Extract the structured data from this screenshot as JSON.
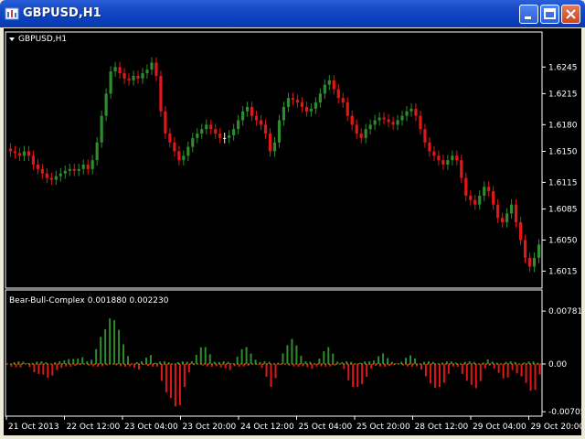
{
  "window": {
    "title": "GBPUSD,H1"
  },
  "colors": {
    "bull": "#2e8b2e",
    "bear": "#e01818",
    "doji": "#ffffff",
    "bg": "#000000",
    "grid": "#ffffff",
    "zero": "#a0a000"
  },
  "main_chart": {
    "label": "GBPUSD,H1",
    "y_labels": [
      "1.6245",
      "1.6215",
      "1.6180",
      "1.6150",
      "1.6115",
      "1.6085",
      "1.6050",
      "1.6015"
    ],
    "y_range": [
      1.6,
      1.627
    ]
  },
  "indicator": {
    "label": "Bear-Bull-Complex 0.001880 0.002230",
    "y_labels": [
      "0.00781",
      "0.00",
      "-0.00705"
    ],
    "y_range": [
      -0.0077,
      0.0085
    ]
  },
  "x_labels": [
    "21 Oct 2013",
    "22 Oct 12:00",
    "23 Oct 04:00",
    "23 Oct 20:00",
    "24 Oct 12:00",
    "25 Oct 04:00",
    "25 Oct 20:00",
    "28 Oct 12:00",
    "29 Oct 04:00",
    "29 Oct 20:00"
  ],
  "chart_data": {
    "type": "candlestick",
    "title": "GBPUSD,H1",
    "y_range": [
      1.6,
      1.627
    ],
    "closes": [
      1.615,
      1.6148,
      1.6145,
      1.615,
      1.6145,
      1.6135,
      1.613,
      1.6125,
      1.612,
      1.6118,
      1.6122,
      1.6125,
      1.6128,
      1.613,
      1.6128,
      1.613,
      1.6135,
      1.613,
      1.614,
      1.616,
      1.619,
      1.6215,
      1.624,
      1.6245,
      1.6238,
      1.6232,
      1.623,
      1.6235,
      1.6232,
      1.6238,
      1.6242,
      1.625,
      1.6235,
      1.6195,
      1.617,
      1.616,
      1.615,
      1.614,
      1.6145,
      1.6155,
      1.6165,
      1.617,
      1.6175,
      1.618,
      1.6175,
      1.617,
      1.6165,
      1.6165,
      1.6168,
      1.6175,
      1.6185,
      1.6195,
      1.62,
      1.619,
      1.6185,
      1.618,
      1.617,
      1.615,
      1.616,
      1.6185,
      1.62,
      1.621,
      1.6208,
      1.6205,
      1.62,
      1.6195,
      1.6198,
      1.6205,
      1.6215,
      1.6225,
      1.623,
      1.622,
      1.621,
      1.6205,
      1.619,
      1.618,
      1.617,
      1.6165,
      1.6175,
      1.618,
      1.6185,
      1.6188,
      1.6186,
      1.6183,
      1.618,
      1.6185,
      1.619,
      1.6195,
      1.6198,
      1.619,
      1.6175,
      1.616,
      1.615,
      1.6145,
      1.614,
      1.6135,
      1.614,
      1.6145,
      1.614,
      1.612,
      1.61,
      1.6095,
      1.609,
      1.61,
      1.611,
      1.6105,
      1.609,
      1.6075,
      1.607,
      1.608,
      1.609,
      1.607,
      1.605,
      1.603,
      1.602,
      1.603,
      1.6045
    ]
  }
}
